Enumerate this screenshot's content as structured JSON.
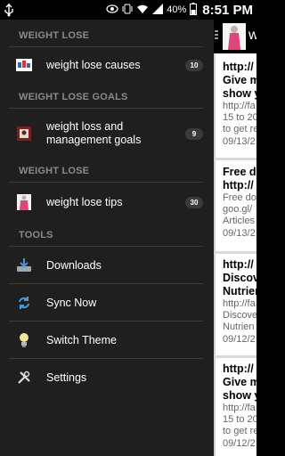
{
  "statusbar": {
    "battery": "40%",
    "time": "8:51 PM"
  },
  "drawer": {
    "sections": [
      {
        "title": "WEIGHT LOSE"
      },
      {
        "title": "WEIGHT LOSE GOALS"
      },
      {
        "title": "WEIGHT LOSE"
      },
      {
        "title": "TOOLS"
      }
    ],
    "items": [
      {
        "label": "weight lose causes",
        "badge": "10"
      },
      {
        "label": "weight loss and management goals",
        "badge": "9"
      },
      {
        "label": "weight lose tips",
        "badge": "30"
      },
      {
        "label": "Downloads"
      },
      {
        "label": "Sync Now"
      },
      {
        "label": "Switch Theme"
      },
      {
        "label": "Settings"
      }
    ]
  },
  "feed": {
    "header_title": "w",
    "cards": [
      {
        "t1": "http://",
        "t2": "Give m",
        "t3": "show y",
        "b1": "http://fa",
        "b2": "15 to 20",
        "b3": "to get re",
        "date": "09/13/2"
      },
      {
        "t1": "Free do",
        "t2": "http://",
        "b1": "Free do",
        "b2": "goo.gl/",
        "b3": "Articles",
        "date": "09/13/2"
      },
      {
        "t1": "http://",
        "t2": "Discov",
        "t3": "Nutrien",
        "b1": "http://fa",
        "b2": "Discove",
        "b3": "Nutrien",
        "date": "09/12/2"
      },
      {
        "t1": "http://",
        "t2": "Give m",
        "t3": "show y",
        "b1": "http://fa",
        "b2": "15 to 20",
        "b3": "to get re",
        "date": "09/12/2"
      }
    ]
  }
}
